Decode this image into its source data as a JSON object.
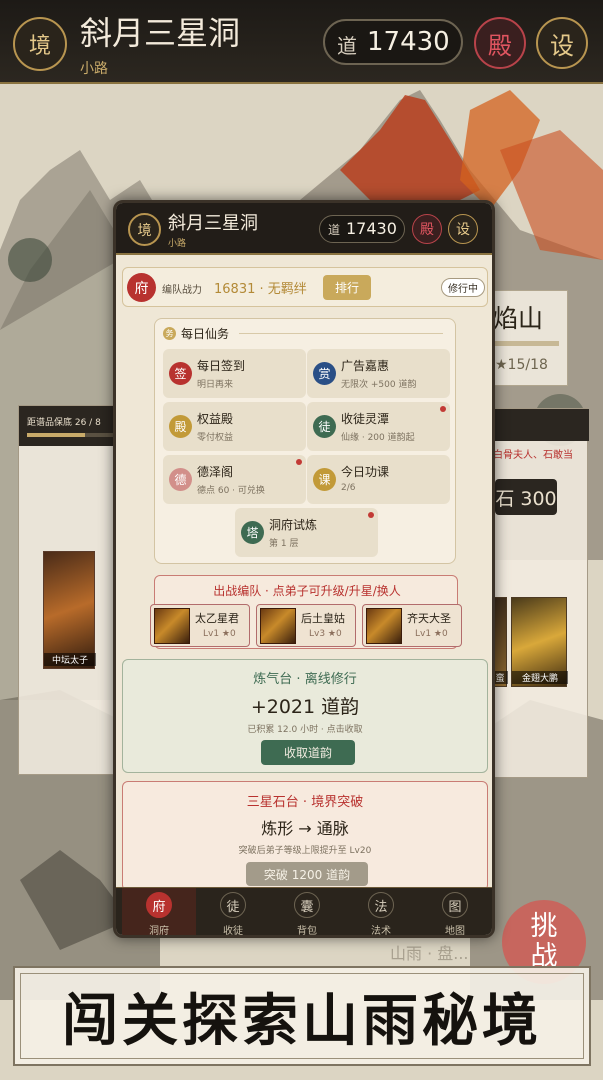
{
  "header": {
    "realm_icon": "境",
    "title": "斜月三星洞",
    "subtitle": "小路",
    "dao_label": "道",
    "dao_value": "17430",
    "hall_icon": "殿",
    "settings_icon": "设"
  },
  "background": {
    "right_card_title": "焰山",
    "right_card_progress": "★15/18",
    "right_card_desc": "白骨夫人、石敢当",
    "right_card_price": "石 300",
    "left_card_label": "距谱品保底 26 / 8",
    "left_unit_name": "中坛太子",
    "right_unit_name_1": "金翅大鹏",
    "right_unit_name_2": "蛮",
    "challenge_button": "挑战",
    "faint_text": "山雨 · 盘..."
  },
  "phone": {
    "header": {
      "realm_icon": "境",
      "title": "斜月三星洞",
      "subtitle": "小路",
      "dao_label": "道",
      "dao_value": "17430",
      "hall_icon": "殿",
      "settings_icon": "设"
    },
    "fu_bar": {
      "icon": "府",
      "power_label": "编队战力",
      "power_value": "16831 · 无羁绊",
      "rank_button": "排行",
      "status": "修行中"
    },
    "daily": {
      "icon": "务",
      "title": "每日仙务",
      "tasks": [
        {
          "icon": "签",
          "title": "每日签到",
          "sub": "明日再来",
          "color": "#b8322f",
          "dot": false
        },
        {
          "icon": "赏",
          "title": "广告嘉惠",
          "sub": "无限次 +500 道韵",
          "color": "#2a4f86",
          "dot": false
        },
        {
          "icon": "殿",
          "title": "权益殿",
          "sub": "零付权益",
          "color": "#c29a38",
          "dot": false
        },
        {
          "icon": "徒",
          "title": "收徒灵潭",
          "sub": "仙缘 · 200 道韵起",
          "color": "#3e6b52",
          "dot": true
        },
        {
          "icon": "德",
          "title": "德泽阁",
          "sub": "德点 60 · 可兑换",
          "color": "#d28f8a",
          "dot": true
        },
        {
          "icon": "课",
          "title": "今日功课",
          "sub": "2/6",
          "color": "#c29a38",
          "dot": false
        },
        {
          "icon": "塔",
          "title": "洞府试炼",
          "sub": "第 1 层",
          "color": "#3e6b52",
          "dot": true
        }
      ]
    },
    "team": {
      "title": "出战编队 · 点弟子可升级/升星/换人",
      "members": [
        {
          "name": "太乙星君",
          "level": "Lv1 ★0"
        },
        {
          "name": "后土皇姑",
          "level": "Lv3 ★0"
        },
        {
          "name": "齐天大圣",
          "level": "Lv1 ★0"
        }
      ]
    },
    "idle": {
      "title": "炼气台 · 离线修行",
      "amount": "+2021 道韵",
      "note": "已积累 12.0 小时 · 点击收取",
      "button": "收取道韵"
    },
    "breakthrough": {
      "title": "三星石台 · 境界突破",
      "stage": "炼形 → 通脉",
      "note": "突破后弟子等级上限提升至 Lv20",
      "button": "突破 1200 道韵"
    },
    "nav": [
      {
        "icon": "府",
        "label": "洞府",
        "active": true
      },
      {
        "icon": "徒",
        "label": "收徒",
        "active": false
      },
      {
        "icon": "囊",
        "label": "背包",
        "active": false
      },
      {
        "icon": "法",
        "label": "法术",
        "active": false
      },
      {
        "icon": "图",
        "label": "地图",
        "active": false
      }
    ]
  },
  "banner": {
    "text": "闯关探索山雨秘境"
  },
  "colors": {
    "gold": "#c9ab6a",
    "red": "#b8322f",
    "green": "#3e6b52",
    "ink": "#221d18"
  }
}
